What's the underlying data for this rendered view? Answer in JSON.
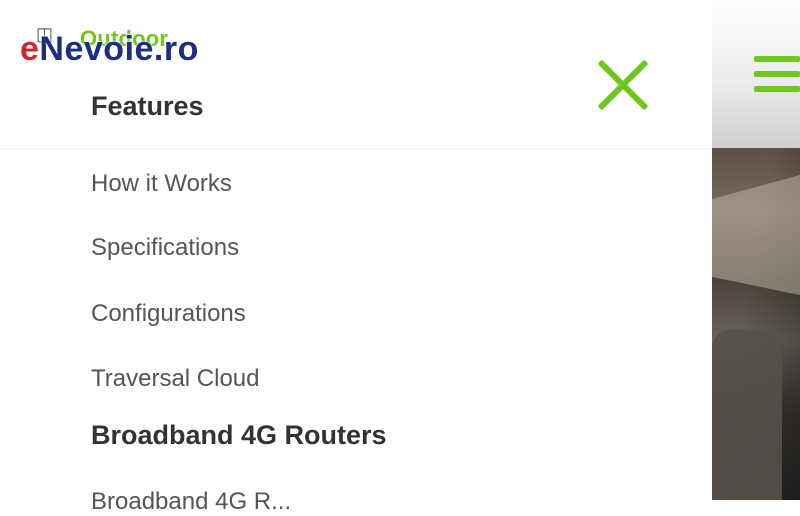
{
  "watermark": {
    "prefix": "e",
    "rest": "Nevoie.ro"
  },
  "drawer": {
    "top_link": "Outdoor",
    "sections": [
      {
        "title": "Features",
        "items": [
          "How it Works",
          "Specifications",
          "Configurations",
          "Traversal Cloud"
        ]
      },
      {
        "title": "Broadband 4G Routers"
      }
    ],
    "cut_off_text": "Broadband 4G R..."
  },
  "colors": {
    "accent": "#6ec61f",
    "heading": "#333333",
    "link": "#555555",
    "watermark_blue": "#1d2e82",
    "watermark_red": "#d8232a"
  },
  "icons": {
    "close": "close-icon",
    "menu": "hamburger-icon",
    "box": "box-icon"
  }
}
